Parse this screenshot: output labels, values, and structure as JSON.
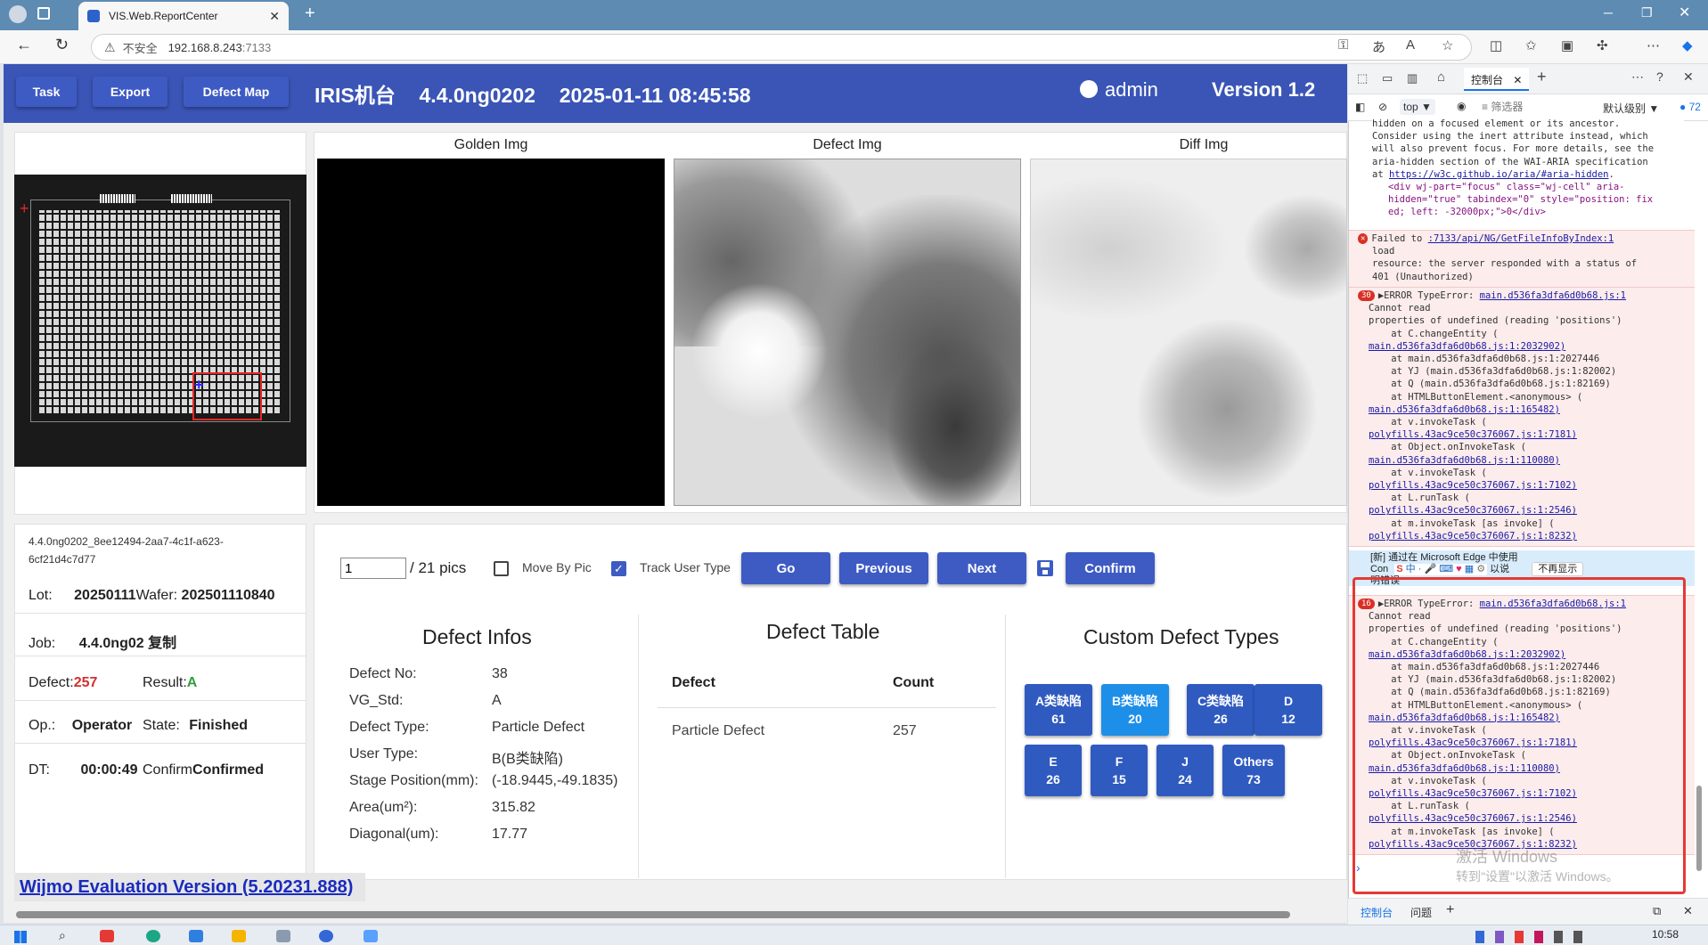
{
  "browser": {
    "tab_title": "VIS.Web.ReportCenter",
    "url_warning": "不安全",
    "url_host": "192.168.8.243",
    "url_port": ":7133"
  },
  "app": {
    "nav": [
      "Task",
      "Export",
      "Defect Map"
    ],
    "machine": "IRIS机台",
    "recipe": "4.4.0ng0202",
    "datetime": "2025-01-11 08:45:58",
    "user": "admin",
    "version": "Version 1.2"
  },
  "panel": {
    "id_line1": "4.4.0ng0202_8ee12494-2aa7-4c1f-a623-",
    "id_line2": "6cf21d4c7d77",
    "lot_label": "Lot:",
    "lot_value": "20250111",
    "wafer_label": "Wafer:",
    "wafer_value": "202501110840",
    "job_label": "Job:",
    "job_value": "4.4.0ng02 复制",
    "defect_label": "Defect:",
    "defect_value": "257",
    "result_label": "Result:",
    "result_value": "A",
    "op_label": "Op.:",
    "op_value": "Operator",
    "state_label": "State:",
    "state_value": "Finished",
    "dt_label": "DT:",
    "dt_value": "00:00:49",
    "confirm_label": "Confirm",
    "confirm_value": "Confirmed"
  },
  "images": {
    "golden": "Golden Img",
    "defect": "Defect Img",
    "diff": "Diff Img"
  },
  "controls": {
    "page_value": "1",
    "page_total": "/ 21 pics",
    "move_by_pic": "Move By Pic",
    "move_by_pic_checked": false,
    "track_user_type": "Track User Type",
    "track_user_type_checked": true,
    "go": "Go",
    "previous": "Previous",
    "next": "Next",
    "confirm": "Confirm"
  },
  "defect_infos": {
    "title": "Defect Infos",
    "rows": [
      {
        "label": "Defect No:",
        "value": "38"
      },
      {
        "label": "VG_Std:",
        "value": "A"
      },
      {
        "label": "Defect Type:",
        "value": "Particle Defect"
      },
      {
        "label": "User Type:",
        "value": "B(B类缺陷)"
      },
      {
        "label": "Stage Position(mm):",
        "value": "(-18.9445,-49.1835)"
      },
      {
        "label": "Area(um²):",
        "value": "315.82"
      },
      {
        "label": "Diagonal(um):",
        "value": "17.77"
      }
    ]
  },
  "defect_table": {
    "title": "Defect Table",
    "col_defect": "Defect",
    "col_count": "Count",
    "rows": [
      {
        "defect": "Particle Defect",
        "count": "257"
      }
    ]
  },
  "custom_types": {
    "title": "Custom Defect Types",
    "items": [
      {
        "label": "A类缺陷",
        "count": "61"
      },
      {
        "label": "B类缺陷",
        "count": "20"
      },
      {
        "label": "C类缺陷",
        "count": "26"
      },
      {
        "label": "D",
        "count": "12"
      },
      {
        "label": "E",
        "count": "26"
      },
      {
        "label": "F",
        "count": "15"
      },
      {
        "label": "J",
        "count": "24"
      },
      {
        "label": "Others",
        "count": "73"
      }
    ]
  },
  "footer": {
    "wijmo": "Wijmo Evaluation Version (5.20231.888)"
  },
  "devtools": {
    "tab_console": "控制台",
    "context": "top",
    "filter_placeholder": "筛选器",
    "level": "默认级别",
    "issues_count": "72",
    "aria_lines": [
      "hidden on a focused element or its ancestor.",
      "Consider using the inert attribute instead, which",
      "will also prevent focus. For more details, see the",
      "aria-hidden section of the WAI-ARIA specification"
    ],
    "aria_at": "at ",
    "aria_link": "https://w3c.github.io/aria/#aria-hidden",
    "aria_div1": "<div wj-part=\"focus\" class=\"wj-cell\" aria-",
    "aria_div2": "hidden=\"true\" tabindex=\"0\" style=\"position: fix",
    "aria_div3": "ed; left: -32000px;\">0</div>",
    "failed_prefix": "Failed to ",
    "failed_link": ":7133/api/NG/GetFileInfoByIndex:1",
    "failed_line2": "load",
    "failed_line3": "resource: the server responded with a status of",
    "failed_line4": "401 (Unauthorized)",
    "err1_count": "30",
    "err2_count": "16",
    "err_title": "▶ERROR TypeError:",
    "err_file": "main.d536fa3dfa6d0b68.js:1",
    "err_lines": [
      "Cannot read",
      "properties of undefined (reading 'positions')",
      "    at C.changeEntity (",
      "main.d536fa3dfa6d0b68.js:1:2032902)",
      "    at main.d536fa3dfa6d0b68.js:1:2027446",
      "    at YJ (main.d536fa3dfa6d0b68.js:1:82002)",
      "    at Q (main.d536fa3dfa6d0b68.js:1:82169)",
      "    at HTMLButtonElement.<anonymous> (",
      "main.d536fa3dfa6d0b68.js:1:165482)",
      "    at v.invokeTask (",
      "polyfills.43ac9ce50c376067.js:1:7181)",
      "    at Object.onInvokeTask (",
      "main.d536fa3dfa6d0b68.js:1:110080)",
      "    at v.invokeTask (",
      "polyfills.43ac9ce50c376067.js:1:7102)",
      "    at L.runTask (",
      "polyfills.43ac9ce50c376067.js:1:2546)",
      "    at m.invokeTask [as invoke] (",
      "polyfills.43ac9ce50c376067.js:1:8232)"
    ],
    "edge_notice": "[新] 通过在 Microsoft Edge 中使用",
    "edge_notice_prefix": "Con",
    "edge_notice_2": "明错误",
    "edge_btn_later": "以说",
    "edge_btn_dismiss": "不再显示",
    "activate1": "激活 Windows",
    "activate2": "转到\"设置\"以激活 Windows。",
    "bottom_tab1": "控制台",
    "bottom_tab2": "问题"
  },
  "taskbar": {
    "time": "10:58"
  }
}
